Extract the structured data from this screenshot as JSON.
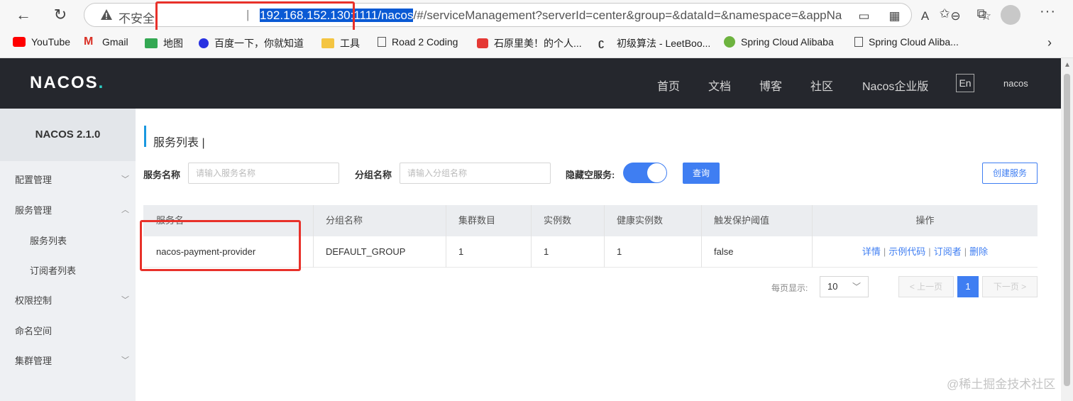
{
  "browser": {
    "back_icon": "←",
    "refresh_icon": "↻",
    "insecure_label": "不安全",
    "separator": "|",
    "url_highlight": "192.168.152.130:1111/nacos",
    "url_rest": "/#/serviceManagement?serverId=center&group=&dataId=&namespace=&appName=",
    "more_icon": "···"
  },
  "bookmarks": [
    {
      "label": "YouTube",
      "color": "#ff0000"
    },
    {
      "label": "Gmail",
      "color": "#d93025"
    },
    {
      "label": "地图",
      "color": "#34a853"
    },
    {
      "label": "百度一下，你就知道",
      "color": "#2932e1"
    },
    {
      "label": "工具",
      "color": "#f4c542"
    },
    {
      "label": "Road 2 Coding",
      "color": "#555555"
    },
    {
      "label": "石原里美！的个人...",
      "color": "#e53935"
    },
    {
      "label": "初级算法 - LeetBoo...",
      "color": "#333333"
    },
    {
      "label": "Spring Cloud Alibaba",
      "color": "#6db33f"
    },
    {
      "label": "Spring Cloud Aliba...",
      "color": "#555555"
    }
  ],
  "header": {
    "logo_main": "NACOS",
    "logo_dot": ".",
    "nav": [
      "首页",
      "文档",
      "博客",
      "社区",
      "Nacos企业版"
    ],
    "lang": "En",
    "user": "nacos"
  },
  "sidebar": {
    "title": "NACOS 2.1.0",
    "items": [
      {
        "label": "配置管理",
        "chevron": "﹀"
      },
      {
        "label": "服务管理",
        "chevron": "︿"
      },
      {
        "label": "服务列表"
      },
      {
        "label": "订阅者列表"
      },
      {
        "label": "权限控制",
        "chevron": "﹀"
      },
      {
        "label": "命名空间"
      },
      {
        "label": "集群管理",
        "chevron": "﹀"
      }
    ]
  },
  "main": {
    "title": "服务列表  |",
    "filters": {
      "service_label": "服务名称",
      "service_placeholder": "请输入服务名称",
      "group_label": "分组名称",
      "group_placeholder": "请输入分组名称",
      "hide_empty_label": "隐藏空服务:",
      "hide_empty_on": true,
      "query_button": "查询",
      "create_button": "创建服务"
    },
    "table": {
      "headers": [
        "服务名",
        "分组名称",
        "集群数目",
        "实例数",
        "健康实例数",
        "触发保护阈值",
        "操作"
      ],
      "rows": [
        {
          "service": "nacos-payment-provider",
          "group": "DEFAULT_GROUP",
          "clusters": "1",
          "instances": "1",
          "healthy": "1",
          "threshold": "false",
          "ops": [
            "详情",
            "示例代码",
            "订阅者",
            "删除"
          ]
        }
      ]
    },
    "pagination": {
      "per_page_label": "每页显示:",
      "per_page": "10",
      "prev": "< 上一页",
      "current": "1",
      "next": "下一页 >"
    }
  },
  "watermark": "@稀土掘金技术社区"
}
